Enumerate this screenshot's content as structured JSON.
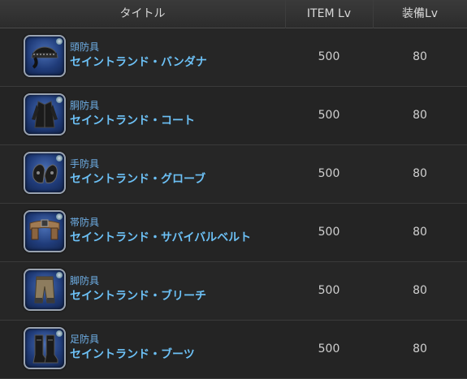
{
  "header": {
    "title": "タイトル",
    "item_lv": "ITEM Lv",
    "equip_lv": "装備Lv"
  },
  "rows": [
    {
      "category": "頭防具",
      "name": "セイントランド・バンダナ",
      "item_lv": "500",
      "equip_lv": "80",
      "icon": "bandana-icon"
    },
    {
      "category": "胴防具",
      "name": "セイントランド・コート",
      "item_lv": "500",
      "equip_lv": "80",
      "icon": "coat-icon"
    },
    {
      "category": "手防具",
      "name": "セイントランド・グローブ",
      "item_lv": "500",
      "equip_lv": "80",
      "icon": "gloves-icon"
    },
    {
      "category": "帯防具",
      "name": "セイントランド・サバイバルベルト",
      "item_lv": "500",
      "equip_lv": "80",
      "icon": "belt-icon"
    },
    {
      "category": "脚防具",
      "name": "セイントランド・ブリーチ",
      "item_lv": "500",
      "equip_lv": "80",
      "icon": "breeches-icon"
    },
    {
      "category": "足防具",
      "name": "セイントランド・ブーツ",
      "item_lv": "500",
      "equip_lv": "80",
      "icon": "boots-icon"
    }
  ],
  "colors": {
    "accent_text": "#6cc0f5",
    "icon_background": "#203c7a"
  }
}
